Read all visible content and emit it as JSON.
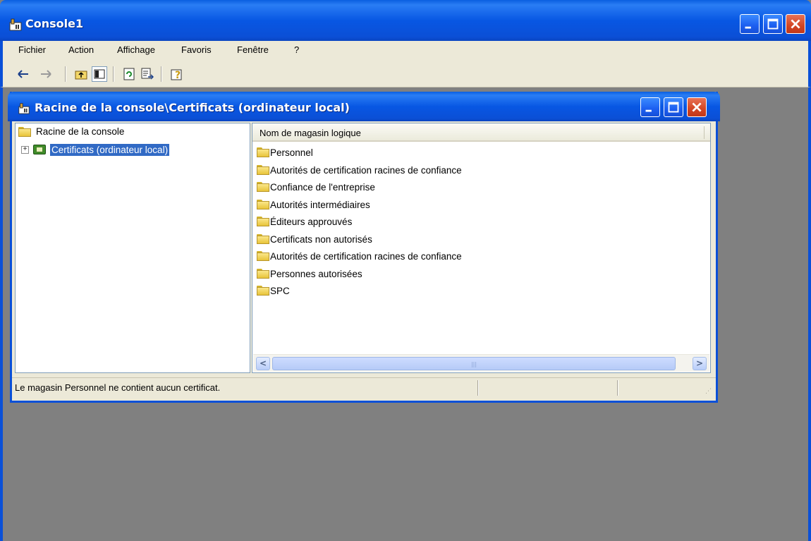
{
  "app": {
    "title": "Console1"
  },
  "menu": {
    "items": [
      "Fichier",
      "Action",
      "Affichage",
      "Favoris",
      "Fenêtre",
      "?"
    ]
  },
  "toolbar": {
    "back_icon": "back-arrow-icon",
    "forward_icon": "forward-arrow-icon",
    "up_icon": "up-one-level-icon",
    "tree_icon": "show-hide-tree-icon",
    "refresh_icon": "refresh-icon",
    "export_icon": "export-list-icon",
    "help_icon": "help-icon"
  },
  "inner_window": {
    "title": "Racine de la console\\Certificats (ordinateur local)"
  },
  "tree": {
    "root_label": "Racine de la console",
    "child_label": "Certificats (ordinateur local)",
    "child_expander": "+"
  },
  "list": {
    "column_header": "Nom de magasin logique",
    "items": [
      "Personnel",
      "Autorités de certification racines de confiance",
      "Confiance de l'entreprise",
      "Autorités intermédiaires",
      "Éditeurs approuvés",
      "Certificats non autorisés",
      "Autorités de certification racines de confiance",
      "Personnes autorisées",
      "SPC"
    ]
  },
  "scrollbar": {
    "left_arrow": "<",
    "right_arrow": ">"
  },
  "status": {
    "text": "Le magasin Personnel ne contient aucun certificat."
  },
  "colors": {
    "titlebar": "#0a5fe0",
    "selection": "#316ac5",
    "chrome": "#ece9d8",
    "mdi_background": "#808080",
    "close_button": "#d34523"
  }
}
